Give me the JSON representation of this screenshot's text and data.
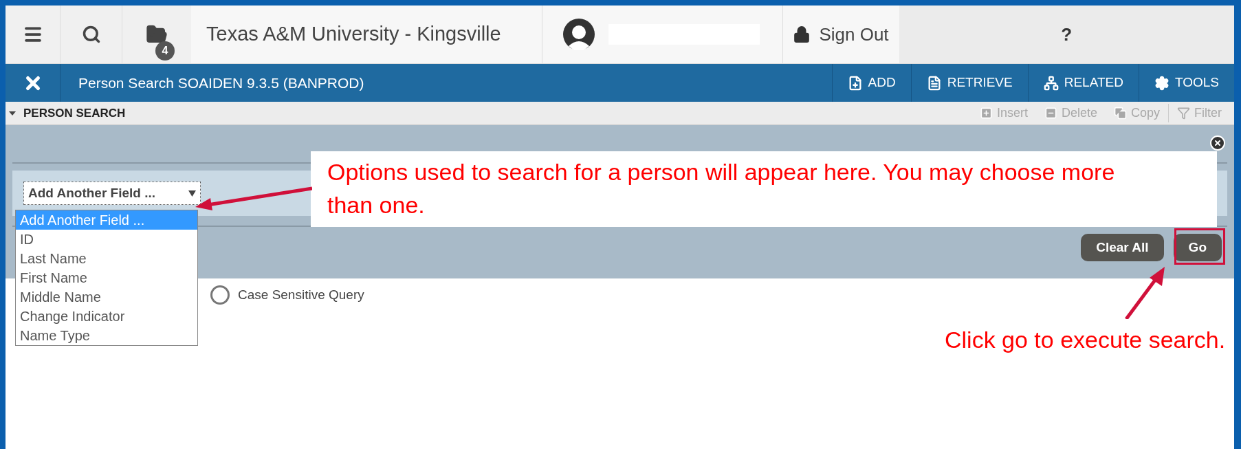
{
  "header": {
    "folder_badge": "4",
    "title": "Texas A&M University - Kingsville",
    "sign_out": "Sign Out",
    "help": "?"
  },
  "toolbar": {
    "title": "Person Search SOAIDEN 9.3.5 (BANPROD)",
    "actions": [
      {
        "kind": "add",
        "label": "ADD"
      },
      {
        "kind": "retrieve",
        "label": "RETRIEVE"
      },
      {
        "kind": "related",
        "label": "RELATED"
      },
      {
        "kind": "tools",
        "label": "TOOLS"
      }
    ]
  },
  "section": {
    "title": "PERSON SEARCH",
    "expanded": true,
    "actions": [
      {
        "kind": "insert",
        "label": "Insert",
        "disabled": true
      },
      {
        "kind": "delete",
        "label": "Delete",
        "disabled": true
      },
      {
        "kind": "copy",
        "label": "Copy",
        "disabled": true
      },
      {
        "kind": "filter",
        "label": "Filter",
        "disabled": true
      }
    ]
  },
  "field_select": {
    "value": "Add Another Field ...",
    "options": [
      {
        "label": "Add Another Field ...",
        "selected": true
      },
      {
        "label": "ID",
        "selected": false
      },
      {
        "label": "Last Name",
        "selected": false
      },
      {
        "label": "First Name",
        "selected": false
      },
      {
        "label": "Middle Name",
        "selected": false
      },
      {
        "label": "Change Indicator",
        "selected": false
      },
      {
        "label": "Name Type",
        "selected": false
      }
    ]
  },
  "buttons": [
    "Clear All",
    "Go"
  ],
  "case_sensitive": {
    "label": "Case Sensitive Query",
    "checked": false
  },
  "annotations": [
    "Options used to search for a person will appear here. You may choose more than one.",
    "Click go to execute search."
  ]
}
